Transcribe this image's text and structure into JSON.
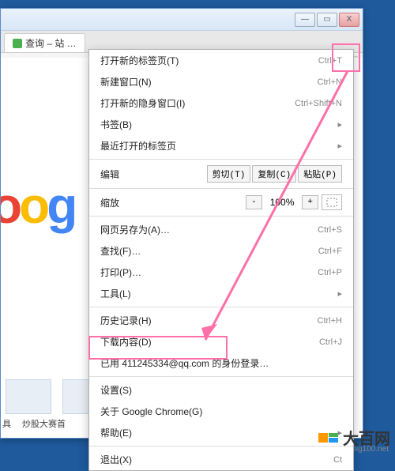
{
  "window": {
    "minimize": "—",
    "maximize": "▭",
    "close": "X"
  },
  "tab": {
    "title": "查询 – 站 …"
  },
  "toolbar": {
    "overflow": "»"
  },
  "logo_fragment": {
    "o1": "o",
    "o2": "o",
    "g": "g"
  },
  "thumbs": {
    "labels": [
      "具",
      "炒股大赛首",
      "",
      ""
    ]
  },
  "menu": {
    "new_tab": {
      "label": "打开新的标签页(T)",
      "shortcut": "Ctrl+T"
    },
    "new_window": {
      "label": "新建窗口(N)",
      "shortcut": "Ctrl+N"
    },
    "new_incognito": {
      "label": "打开新的隐身窗口(I)",
      "shortcut": "Ctrl+Shift+N"
    },
    "bookmarks": {
      "label": "书签(B)"
    },
    "recent_tabs": {
      "label": "最近打开的标签页"
    },
    "edit": {
      "label": "编辑",
      "cut": "剪切(T)",
      "copy": "复制(C)",
      "paste": "粘贴(P)"
    },
    "zoom": {
      "label": "缩放",
      "minus": "-",
      "value": "100%",
      "plus": "+"
    },
    "save_as": {
      "label": "网页另存为(A)…",
      "shortcut": "Ctrl+S"
    },
    "find": {
      "label": "查找(F)…",
      "shortcut": "Ctrl+F"
    },
    "print": {
      "label": "打印(P)…",
      "shortcut": "Ctrl+P"
    },
    "tools": {
      "label": "工具(L)"
    },
    "history": {
      "label": "历史记录(H)",
      "shortcut": "Ctrl+H"
    },
    "downloads": {
      "label": "下载内容(D)",
      "shortcut": "Ctrl+J"
    },
    "signed_in": {
      "prefix": "已用 ",
      "email": "411245334@qq.com",
      "suffix": " 的身份登录…"
    },
    "settings": {
      "label": "设置(S)"
    },
    "about": {
      "label": "关于 Google Chrome(G)"
    },
    "help": {
      "label": "帮助(E)"
    },
    "exit": {
      "label": "退出(X)",
      "shortcut": "Ct"
    }
  },
  "watermark": {
    "text": "大百网",
    "sub": "big100.net"
  },
  "colors": {
    "highlight": "#ff6fa8",
    "bg": "#1e5a9c"
  }
}
